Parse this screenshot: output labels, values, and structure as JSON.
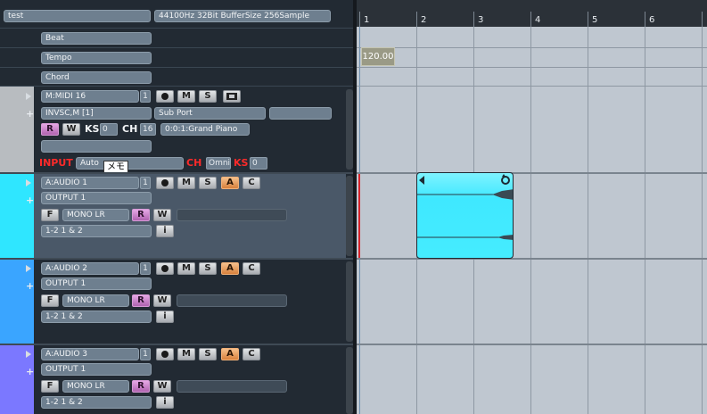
{
  "project": {
    "name": "test",
    "audio_info": "44100Hz 32Bit BufferSize 256Sample"
  },
  "global_tracks": [
    {
      "label": "Beat"
    },
    {
      "label": "Tempo"
    },
    {
      "label": "Chord"
    }
  ],
  "midi_track": {
    "name": "M:MIDI 16",
    "number": "1",
    "input_device": "INVSC,M [1]",
    "port": "Sub Port",
    "ks_label": "KS",
    "ks_value": "0",
    "ch_label": "CH",
    "ch_value": "16",
    "instrument": "0:0:1:Grand Piano",
    "input_label": "INPUT",
    "input_value": "Auto",
    "input_ch_label": "CH",
    "input_ch_value": "Omni",
    "input_ks_label": "KS",
    "input_ks_value": "0",
    "tooltip": "メモ",
    "color": "#b8bcc0"
  },
  "audio_tracks": [
    {
      "name": "A:AUDIO 1",
      "number": "1",
      "output": "OUTPUT 1",
      "mono": "MONO LR",
      "routing": "1-2 1 & 2",
      "color": "#2fe6ff"
    },
    {
      "name": "A:AUDIO 2",
      "number": "1",
      "output": "OUTPUT 1",
      "mono": "MONO LR",
      "routing": "1-2 1 & 2",
      "color": "#3aa5ff"
    },
    {
      "name": "A:AUDIO 3",
      "number": "1",
      "output": "OUTPUT 1",
      "mono": "MONO LR",
      "routing": "1-2 1 & 2",
      "color": "#7b78ff"
    }
  ],
  "buttons": {
    "mute": "M",
    "solo": "S",
    "read": "R",
    "write": "W",
    "audition": "A",
    "clip": "C",
    "freeze": "F",
    "info": "i"
  },
  "ruler": {
    "bars": [
      "1",
      "2",
      "3",
      "4",
      "5",
      "6"
    ]
  },
  "tempo_value": "120.00",
  "clip_color": "#47ecff",
  "selected_track_color": "#4a5868"
}
